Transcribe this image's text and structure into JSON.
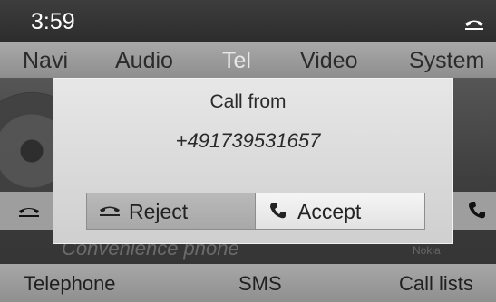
{
  "status": {
    "time": "3:59",
    "handset_icon": "handset-icon"
  },
  "main_menu": {
    "items": [
      "Navi",
      "Audio",
      "Tel",
      "Video",
      "System"
    ],
    "active": "Tel"
  },
  "background": {
    "caption": "Convenience phone",
    "small_text": "Nokia"
  },
  "dialog": {
    "title": "Call from",
    "number": "+491739531657",
    "reject_label": "Reject",
    "accept_label": "Accept"
  },
  "bottom_bar": {
    "items": [
      "Telephone",
      "SMS",
      "Call lists"
    ]
  }
}
